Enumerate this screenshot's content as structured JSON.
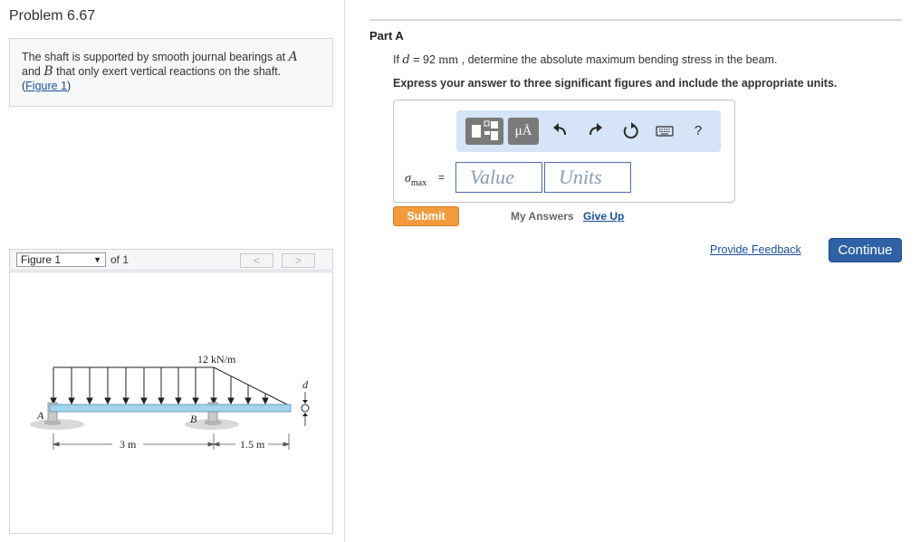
{
  "problem": {
    "title": "Problem 6.67",
    "statement_1": "The shaft is supported by smooth journal bearings at ",
    "var_a": "A",
    "statement_2": " and ",
    "var_b": "B",
    "statement_3": " that only exert vertical reactions on the shaft.",
    "figure_link_open": "(",
    "figure_link": "Figure 1",
    "figure_link_close": ")"
  },
  "figure_nav": {
    "selected": "Figure 1",
    "of_label": "of 1",
    "prev_label": "<",
    "next_label": ">"
  },
  "figure": {
    "load_label": "12 kN/m",
    "label_a": "A",
    "label_b": "B",
    "label_d": "d",
    "dim_1": "3 m",
    "dim_2": "1.5 m"
  },
  "part": {
    "title": "Part A",
    "question_pre": "If ",
    "question_var": "d",
    "question_eq": " = 92 ",
    "question_unit": "mm",
    "question_post": " , determine the absolute maximum bending stress in the beam.",
    "instructions": "Express your answer to three significant figures and include the appropriate units."
  },
  "toolbar": {
    "units_label": "μÅ",
    "undo_icon": "undo-icon",
    "redo_icon": "redo-icon",
    "reset_icon": "reset-icon",
    "keyboard_icon": "keyboard-icon",
    "help_label": "?"
  },
  "answer": {
    "sigma": "σ",
    "sigma_sub": "max",
    "equals": "=",
    "value_placeholder": "Value",
    "units_placeholder": "Units"
  },
  "actions": {
    "submit": "Submit",
    "my_answers": "My Answers",
    "give_up": "Give Up",
    "provide_feedback": "Provide Feedback",
    "continue": "Continue"
  },
  "colors": {
    "submit": "#f39a3c",
    "continue": "#2f62a5",
    "toolbar": "#d5e4f6",
    "link": "#1a4f9c",
    "beam": "#9fd3ef"
  }
}
